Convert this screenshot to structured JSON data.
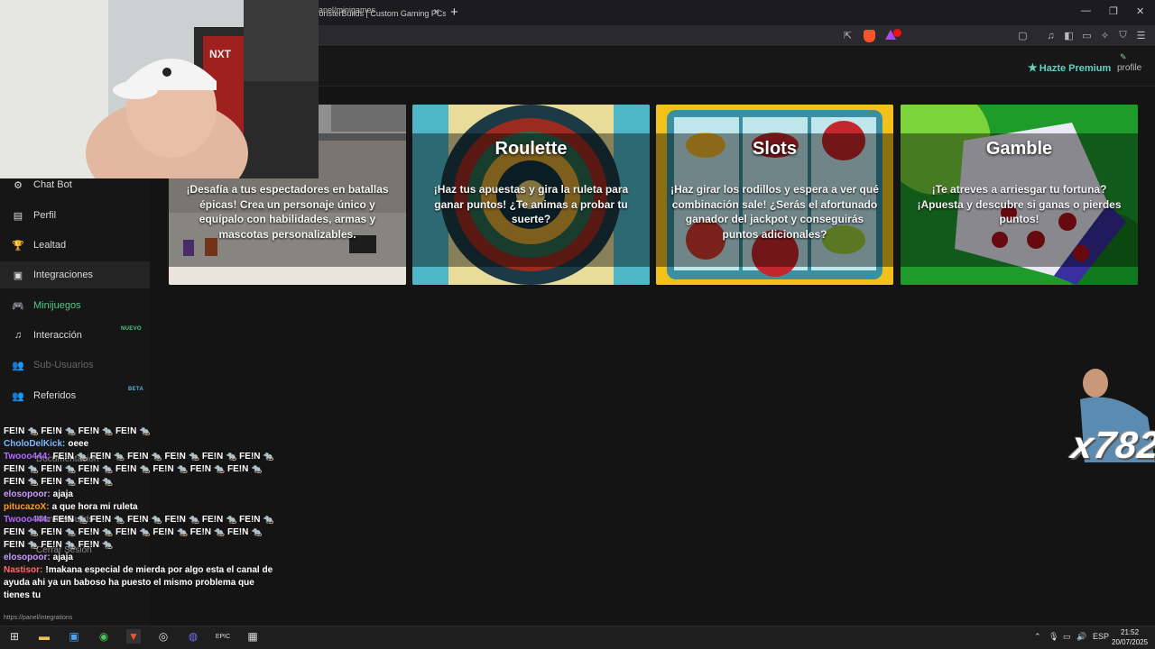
{
  "browser": {
    "tab_title": "MonsterBuilds | Custom Gaming PCs",
    "new_tab": "+",
    "url": "anel/minigames",
    "window_controls": {
      "minimize": "—",
      "restore": "❐",
      "close": "✕"
    }
  },
  "header": {
    "premium_label": "Hazte Premium",
    "profile_label": "profile"
  },
  "sidebar": {
    "items": [
      {
        "label": "Chat Bot",
        "icon": "chat-bot-icon",
        "glyph": "⚙"
      },
      {
        "label": "Perfil",
        "icon": "profile-card-icon",
        "glyph": "▤"
      },
      {
        "label": "Lealtad",
        "icon": "trophy-icon",
        "glyph": "🏆"
      },
      {
        "label": "Integraciones",
        "icon": "integrations-icon",
        "glyph": "▣"
      },
      {
        "label": "Minijuegos",
        "icon": "gamepad-icon",
        "glyph": "🎮"
      },
      {
        "label": "Interacción",
        "icon": "music-note-icon",
        "glyph": "♫",
        "badge": "NUEVO"
      },
      {
        "label": "Sub-Usuarios",
        "icon": "users-icon",
        "glyph": "👥"
      },
      {
        "label": "Referidos",
        "icon": "referral-icon",
        "glyph": "👥",
        "badge": "BETA"
      }
    ],
    "ghost_items": [
      "Documentación",
      "MonsterBuilds",
      "Cerrar Sesión"
    ]
  },
  "cards": [
    {
      "title": "",
      "description": "¡Desafía a tus espectadores en batallas épicas! Crea un personaje único y equípalo con habilidades, armas y mascotas personalizables."
    },
    {
      "title": "Roulette",
      "description": "¡Haz tus apuestas y gira la ruleta para ganar puntos! ¿Te animas a probar tu suerte?"
    },
    {
      "title": "Slots",
      "description": "¡Haz girar los rodillos y espera a ver qué combinación sale! ¿Serás el afortunado ganador del jackpot y conseguirás puntos adicionales?"
    },
    {
      "title": "Gamble",
      "description": "¡Te atreves a arriesgar tu fortuna? ¡Apuesta y descubre si ganas o pierdes puntos!"
    }
  ],
  "overlay": {
    "multiplier": "x782"
  },
  "chat": [
    {
      "user": "",
      "color": "#ffffff",
      "text": "FE!N 🐀 FE!N 🐀 FE!N 🐀 FE!N 🐀"
    },
    {
      "user": "CholoDelKick:",
      "color": "#7fb8ff",
      "text": "oeee"
    },
    {
      "user": "Twooo444:",
      "color": "#b06cff",
      "text": "FE!N 🐀 FE!N 🐀 FE!N 🐀 FE!N 🐀 FE!N 🐀 FE!N 🐀 FE!N 🐀 FE!N 🐀 FE!N 🐀 FE!N 🐀 FE!N 🐀 FE!N 🐀 FE!N 🐀 FE!N 🐀 FE!N 🐀 FE!N 🐀"
    },
    {
      "user": "elosopoor:",
      "color": "#c79bff",
      "text": "ajaja"
    },
    {
      "user": "pitucazoX:",
      "color": "#ff9a2e",
      "text": "a que hora mi ruleta"
    },
    {
      "user": "Twooo444:",
      "color": "#b06cff",
      "text": "FE!N 🐀 FE!N 🐀 FE!N 🐀 FE!N 🐀 FE!N 🐀 FE!N 🐀 FE!N 🐀 FE!N 🐀 FE!N 🐀 FE!N 🐀 FE!N 🐀 FE!N 🐀 FE!N 🐀 FE!N 🐀 FE!N 🐀 FE!N 🐀"
    },
    {
      "user": "elosopoor:",
      "color": "#c79bff",
      "text": "ajaja"
    },
    {
      "user": "Nastisor:",
      "color": "#ff6b6b",
      "text": "!makana especial de mierda por algo esta el canal de ayuda ahi ya un baboso ha puesto el mismo problema que tienes tu"
    }
  ],
  "status_url": "https://panel/integrations",
  "taskbar": {
    "language": "ESP",
    "time": "21:52",
    "date": "20/07/2025"
  },
  "colors": {
    "accent_green": "#4fc98e",
    "premium_teal": "#5fd3c4"
  }
}
